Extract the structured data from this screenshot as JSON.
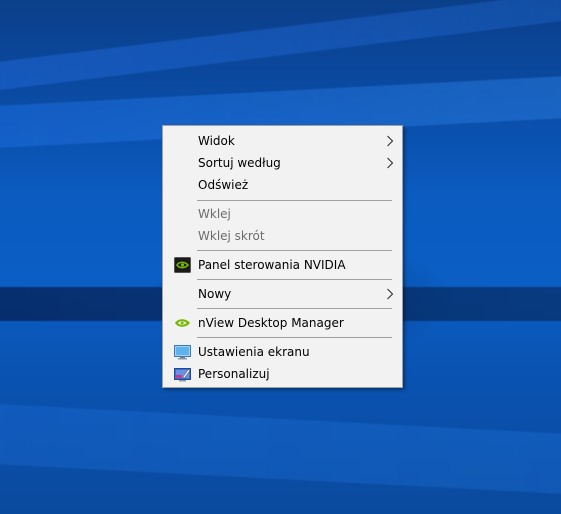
{
  "context_menu": {
    "items": [
      {
        "label": "Widok",
        "icon": null,
        "has_submenu": true,
        "enabled": true
      },
      {
        "label": "Sortuj według",
        "icon": null,
        "has_submenu": true,
        "enabled": true
      },
      {
        "label": "Odśwież",
        "icon": null,
        "has_submenu": false,
        "enabled": true
      },
      {
        "label": "Wklej",
        "icon": null,
        "has_submenu": false,
        "enabled": false
      },
      {
        "label": "Wklej skrót",
        "icon": null,
        "has_submenu": false,
        "enabled": false
      },
      {
        "label": "Panel sterowania NVIDIA",
        "icon": "nvidia-control-panel-icon",
        "has_submenu": false,
        "enabled": true
      },
      {
        "label": "Nowy",
        "icon": null,
        "has_submenu": true,
        "enabled": true
      },
      {
        "label": "nView Desktop Manager",
        "icon": "nvidia-nview-icon",
        "has_submenu": false,
        "enabled": true
      },
      {
        "label": "Ustawienia ekranu",
        "icon": "display-settings-icon",
        "has_submenu": false,
        "enabled": true
      },
      {
        "label": "Personalizuj",
        "icon": "personalize-icon",
        "has_submenu": false,
        "enabled": true
      }
    ]
  },
  "colors": {
    "menu_background": "#f2f2f2",
    "menu_border": "#a0a0a0",
    "disabled_text": "#6d6d6d",
    "nvidia_green": "#76b900",
    "desktop_blue": "#0b5ec4"
  }
}
